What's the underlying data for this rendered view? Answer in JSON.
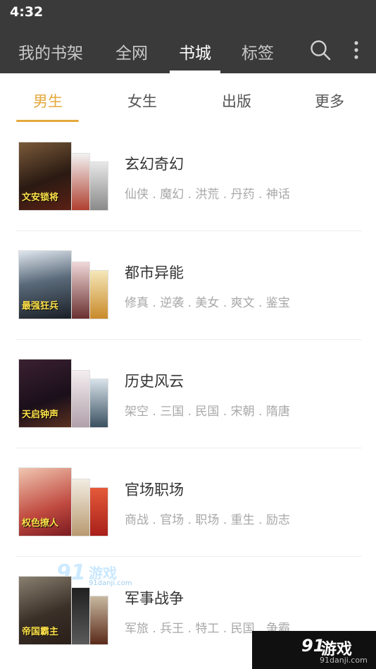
{
  "status_bar": {
    "time": "4:32"
  },
  "top_nav": {
    "tabs": [
      {
        "label": "我的书架",
        "active": false
      },
      {
        "label": "全网",
        "active": false
      },
      {
        "label": "书城",
        "active": true
      },
      {
        "label": "标签",
        "active": false
      }
    ]
  },
  "sub_tabs": [
    {
      "label": "男生",
      "active": true
    },
    {
      "label": "女生",
      "active": false
    },
    {
      "label": "出版",
      "active": false
    },
    {
      "label": "更多",
      "active": false
    }
  ],
  "categories": [
    {
      "title": "玄幻奇幻",
      "tags": "仙侠 . 魔幻 . 洪荒 . 丹药 . 神话",
      "cover_text": "文安锁将"
    },
    {
      "title": "都市异能",
      "tags": "修真 . 逆袭 . 美女 . 爽文 . 鉴宝",
      "cover_text": "最强狂兵"
    },
    {
      "title": "历史风云",
      "tags": "架空 . 三国 . 民国 . 宋朝 . 隋唐",
      "cover_text": "天启钟声"
    },
    {
      "title": "官场职场",
      "tags": "商战 . 官场 . 职场 . 重生 . 励志",
      "cover_text": "权色撩人"
    },
    {
      "title": "军事战争",
      "tags": "军旅 . 兵王 . 特工 . 民国 . 争霸",
      "cover_text": "帝国霸主"
    }
  ],
  "watermark": {
    "logo": "91",
    "name": "游戏",
    "domain": "91danji.com"
  },
  "colors": {
    "header_bg": "#3a3a3a",
    "accent": "#e4a93e",
    "title_text": "#333333",
    "tag_text": "#a8a8a8"
  },
  "icons": {
    "search": "search-icon",
    "more": "more-vertical-icon"
  }
}
